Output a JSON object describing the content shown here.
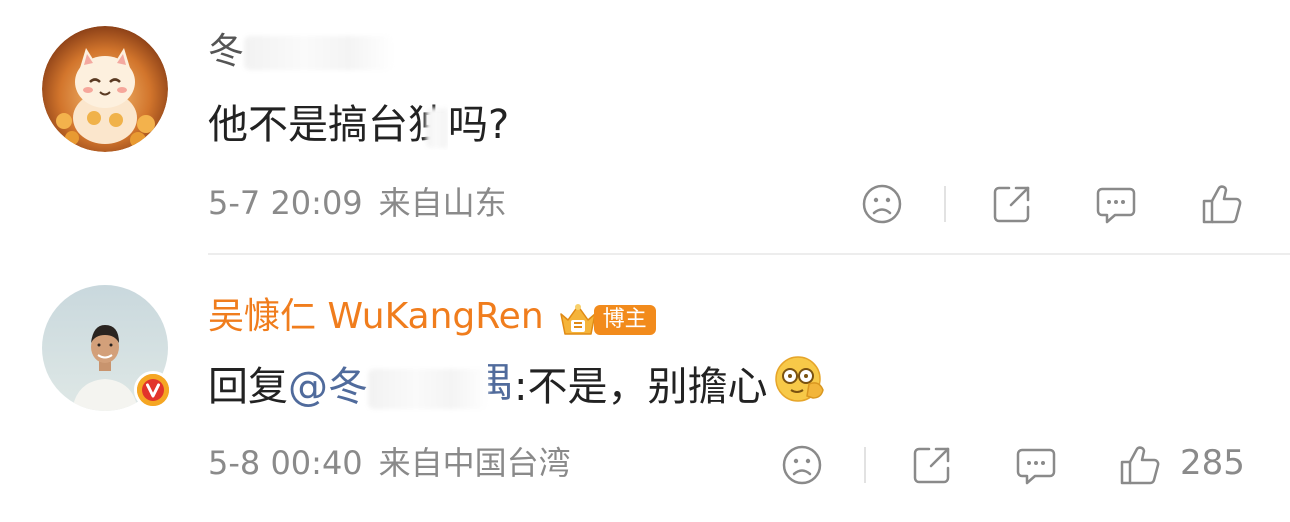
{
  "comments": [
    {
      "username_visible": "冬",
      "content_before": "他不是搞台",
      "content_partial_char": "独",
      "content_after": "吗?",
      "date": "5-7 20:09",
      "location": "来自山东",
      "icons": {
        "avatar": "cat-avatar",
        "dislike": "sad-face-icon",
        "share": "share-icon",
        "comment": "comment-icon",
        "like": "thumbs-up-icon"
      }
    },
    {
      "username": "吴慷仁 WuKangRen",
      "badge_label": "博主",
      "reply_prefix": "回复",
      "mention_visible": "@冬",
      "mention_tail": "禺",
      "reply_text": ":不是，别擔心",
      "date": "5-8 00:40",
      "location": "来自中国台湾",
      "like_count": "285",
      "icons": {
        "avatar": "person-avatar",
        "verified": "verified-v-icon",
        "badge": "crown-badge-icon",
        "emoji": "facepalm-emoji-icon",
        "dislike": "sad-face-icon",
        "share": "share-icon",
        "comment": "comment-icon",
        "like": "thumbs-up-icon"
      }
    }
  ],
  "colors": {
    "author_name": "#f07d1d",
    "mention": "#506b9c",
    "meta": "#8a8a8a",
    "badge": "#f28b1c"
  }
}
